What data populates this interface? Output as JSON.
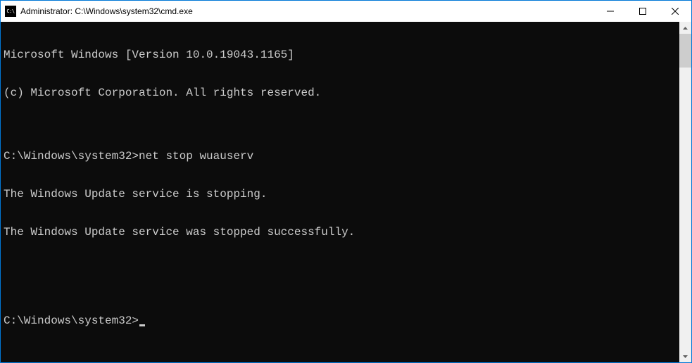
{
  "titlebar": {
    "title": "Administrator: C:\\Windows\\system32\\cmd.exe"
  },
  "terminal": {
    "lines": [
      "Microsoft Windows [Version 10.0.19043.1165]",
      "(c) Microsoft Corporation. All rights reserved.",
      "",
      "C:\\Windows\\system32>net stop wuauserv",
      "The Windows Update service is stopping.",
      "The Windows Update service was stopped successfully.",
      "",
      ""
    ],
    "prompt": "C:\\Windows\\system32>"
  }
}
